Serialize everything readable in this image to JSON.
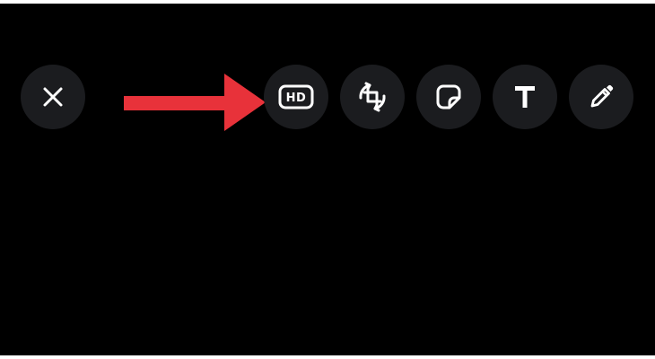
{
  "toolbar": {
    "close_icon": "close-icon",
    "hd_label": "HD",
    "hd_icon": "hd-quality-icon",
    "crop_icon": "crop-rotate-icon",
    "sticker_icon": "sticker-icon",
    "text_icon": "text-icon",
    "draw_icon": "pencil-icon"
  },
  "annotation": {
    "arrow_icon": "red-arrow-icon",
    "arrow_color": "#e8323a"
  },
  "colors": {
    "background": "#000000",
    "button_bg": "#1b1c1f",
    "icon": "#ffffff"
  }
}
